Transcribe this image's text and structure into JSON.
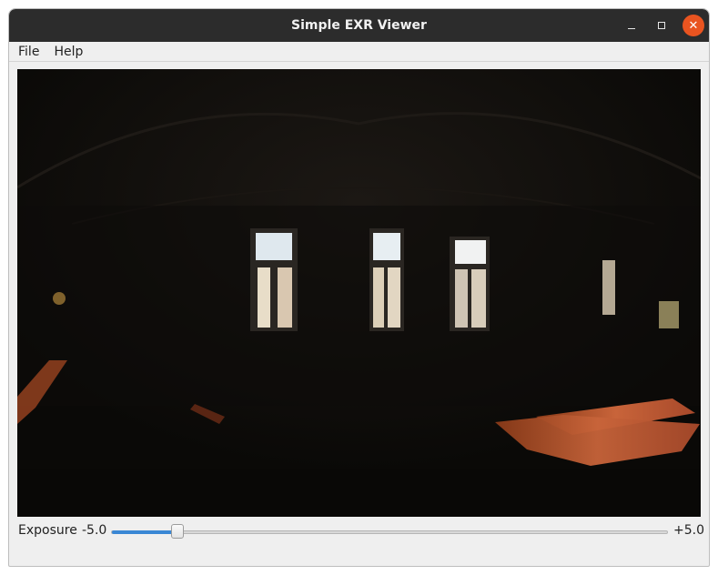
{
  "window": {
    "title": "Simple EXR Viewer"
  },
  "menu": {
    "items": [
      "File",
      "Help"
    ]
  },
  "exposure": {
    "label": "Exposure",
    "min_label": "-5.0",
    "max_label": "+5.0",
    "min": -5.0,
    "max": 5.0,
    "value": -3.8
  },
  "colors": {
    "titlebar": "#2c2c2c",
    "close_button": "#e95420",
    "slider_fill": "#3a87d4",
    "viewer_bg": "#0d0b09"
  },
  "icons": {
    "minimize": "minimize-icon",
    "maximize": "maximize-icon",
    "close": "close-icon"
  }
}
